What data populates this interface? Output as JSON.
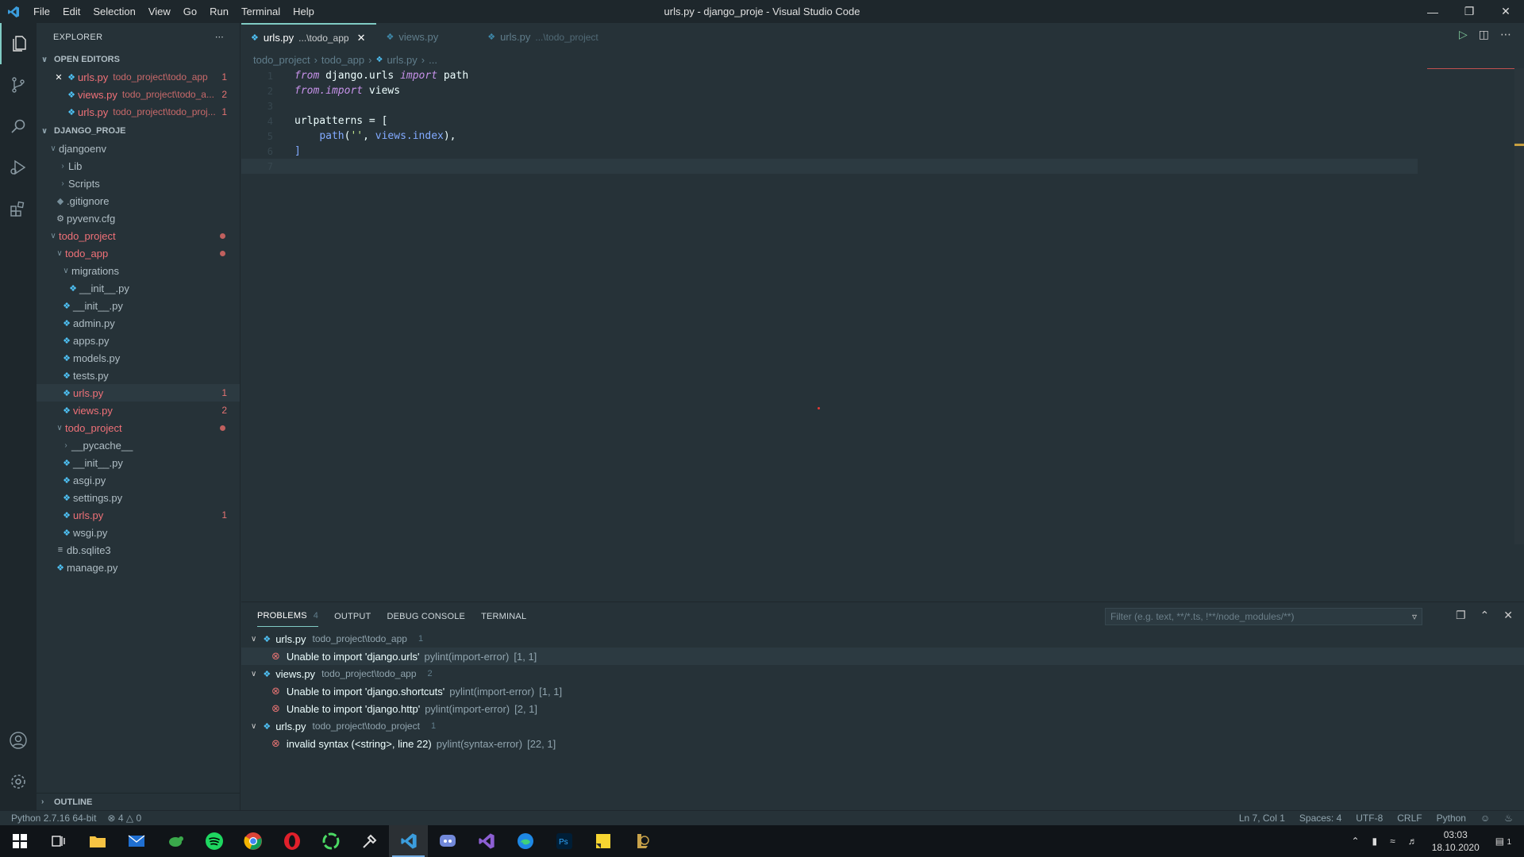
{
  "window": {
    "title": "urls.py - django_proje - Visual Studio Code",
    "menu": [
      "File",
      "Edit",
      "Selection",
      "View",
      "Go",
      "Run",
      "Terminal",
      "Help"
    ]
  },
  "explorer": {
    "header": "EXPLORER",
    "open_editors_title": "OPEN EDITORS",
    "open_editors": [
      {
        "name": "urls.py",
        "path": "todo_project\\todo_app",
        "badge": "1"
      },
      {
        "name": "views.py",
        "path": "todo_project\\todo_a...",
        "badge": "2"
      },
      {
        "name": "urls.py",
        "path": "todo_project\\todo_proj...",
        "badge": "1"
      }
    ],
    "project_title": "DJANGO_PROJE",
    "tree": {
      "djangoenv": "djangoenv",
      "lib": "Lib",
      "scripts": "Scripts",
      "gitignore": ".gitignore",
      "pyvenv": "pyvenv.cfg",
      "todo_project": "todo_project",
      "todo_app": "todo_app",
      "migrations": "migrations",
      "mig_init": "__init__.py",
      "app_init": "__init__.py",
      "admin": "admin.py",
      "apps": "apps.py",
      "models": "models.py",
      "tests": "tests.py",
      "app_urls": "urls.py",
      "app_urls_badge": "1",
      "views": "views.py",
      "views_badge": "2",
      "todo_project_inner": "todo_project",
      "pycache": "__pycache__",
      "proj_init": "__init__.py",
      "asgi": "asgi.py",
      "settings": "settings.py",
      "proj_urls": "urls.py",
      "proj_urls_badge": "1",
      "wsgi": "wsgi.py",
      "db": "db.sqlite3",
      "manage": "manage.py"
    },
    "outline_title": "OUTLINE"
  },
  "tabs": [
    {
      "name": "urls.py",
      "path": "...\\todo_app"
    },
    {
      "name": "views.py",
      "path": ""
    },
    {
      "name": "urls.py",
      "path": "...\\todo_project"
    }
  ],
  "breadcrumb": [
    "todo_project",
    "todo_app",
    "urls.py",
    "..."
  ],
  "code": {
    "line_numbers": [
      "1",
      "2",
      "3",
      "4",
      "5",
      "6",
      "7"
    ],
    "l1": {
      "kw1": "from",
      "mod": " django.urls ",
      "kw2": "import",
      "name": " path"
    },
    "l2": {
      "kw1": "from",
      "kw2": ".import",
      "name": " views"
    },
    "l4": {
      "name": "urlpatterns = ["
    },
    "l5": {
      "indent": "    ",
      "fn": "path",
      "open": "(",
      "str": "''",
      "comma": ", ",
      "ref": "views.index",
      "close": "),"
    },
    "l6": {
      "name": "]"
    }
  },
  "panel": {
    "tabs": {
      "problems": "PROBLEMS",
      "problems_count": "4",
      "output": "OUTPUT",
      "debug": "DEBUG CONSOLE",
      "terminal": "TERMINAL"
    },
    "filter_placeholder": "Filter (e.g. text, **/*.ts, !**/node_modules/**)",
    "groups": [
      {
        "file": "urls.py",
        "path": "todo_project\\todo_app",
        "count": "1",
        "items": [
          {
            "msg": "Unable to import 'django.urls'",
            "src": "pylint(import-error)",
            "loc": "[1, 1]"
          }
        ]
      },
      {
        "file": "views.py",
        "path": "todo_project\\todo_app",
        "count": "2",
        "items": [
          {
            "msg": "Unable to import 'django.shortcuts'",
            "src": "pylint(import-error)",
            "loc": "[1, 1]"
          },
          {
            "msg": "Unable to import 'django.http'",
            "src": "pylint(import-error)",
            "loc": "[2, 1]"
          }
        ]
      },
      {
        "file": "urls.py",
        "path": "todo_project\\todo_project",
        "count": "1",
        "items": [
          {
            "msg": "invalid syntax (<string>, line 22)",
            "src": "pylint(syntax-error)",
            "loc": "[22, 1]"
          }
        ]
      }
    ]
  },
  "statusbar": {
    "interpreter": "Python 2.7.16 64-bit",
    "errors": "4",
    "warnings": "0",
    "position": "Ln 7, Col 1",
    "spaces": "Spaces: 4",
    "encoding": "UTF-8",
    "eol": "CRLF",
    "language": "Python"
  },
  "taskbar": {
    "time": "03:03",
    "date": "18.10.2020",
    "notification_count": "1"
  },
  "colors": {
    "accent": "#80cbc4",
    "error": "#e57373",
    "background": "#263238"
  }
}
